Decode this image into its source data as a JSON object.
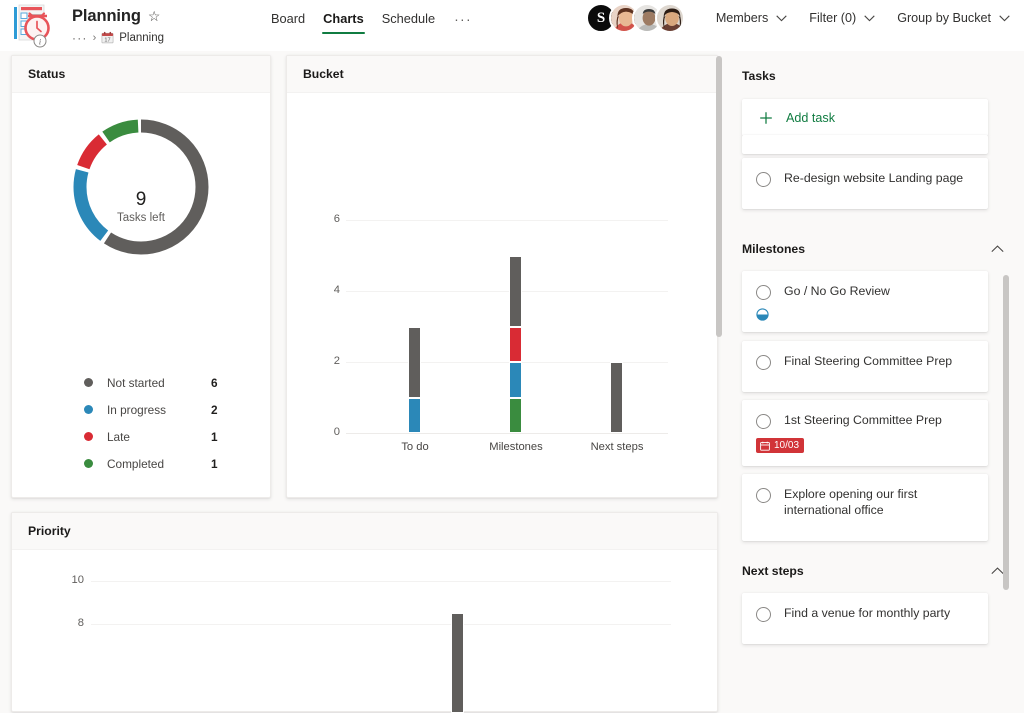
{
  "app": {
    "icon": "planner-app-icon",
    "plan_title": "Planning",
    "favorite_icon": "star-icon",
    "breadcrumb": {
      "overflow": "···",
      "separator": "›",
      "calendar_icon": "calendar-17-icon",
      "calendar_day": "17",
      "name": "Planning"
    }
  },
  "tabs": [
    {
      "label": "Board",
      "active": false
    },
    {
      "label": "Charts",
      "active": true
    },
    {
      "label": "Schedule",
      "active": false
    }
  ],
  "tabs_overflow": "···",
  "avatars": [
    {
      "name": "avatar-badge",
      "initial": "S",
      "type": "badge"
    },
    {
      "name": "avatar-person-1",
      "type": "photo"
    },
    {
      "name": "avatar-person-2",
      "type": "photo"
    },
    {
      "name": "avatar-person-3",
      "type": "photo"
    }
  ],
  "top_controls": [
    {
      "label": "Members",
      "icon": "chevron-down-icon"
    },
    {
      "label": "Filter (0)",
      "icon": "chevron-down-icon"
    },
    {
      "label": "Group by Bucket",
      "icon": "chevron-down-icon"
    }
  ],
  "cards": {
    "status_title": "Status",
    "bucket_title": "Bucket",
    "priority_title": "Priority"
  },
  "colors": {
    "not_started": "#605e5c",
    "in_progress": "#2b88b8",
    "late": "#d92b34",
    "completed": "#3a8c3f",
    "accent_green": "#107c41",
    "due_red": "#d13438"
  },
  "chart_data": [
    {
      "type": "pie",
      "name": "status-donut",
      "title": "Status",
      "center_value": "9",
      "center_label": "Tasks left",
      "total": 10,
      "categories": [
        "Not started",
        "In progress",
        "Late",
        "Completed"
      ],
      "values": [
        6,
        2,
        1,
        1
      ],
      "colors": [
        "#605e5c",
        "#2b88b8",
        "#d92b34",
        "#3a8c3f"
      ],
      "legend_position": "bottom",
      "donut": true,
      "start_angle": 0
    },
    {
      "type": "bar",
      "name": "bucket-stacked-bar",
      "title": "Bucket",
      "stacked": true,
      "categories": [
        "To do",
        "Milestones",
        "Next steps"
      ],
      "series": [
        {
          "name": "Completed",
          "color": "#3a8c3f",
          "values": [
            0,
            1,
            0
          ]
        },
        {
          "name": "In progress",
          "color": "#2b88b8",
          "values": [
            1,
            1,
            0
          ]
        },
        {
          "name": "Late",
          "color": "#d92b34",
          "values": [
            0,
            1,
            0
          ]
        },
        {
          "name": "Not started",
          "color": "#605e5c",
          "values": [
            2,
            2,
            2
          ]
        }
      ],
      "totals": [
        3,
        5,
        2
      ],
      "yticks": [
        0,
        2,
        4,
        6
      ],
      "ylim": [
        0,
        7
      ],
      "xlabel": "",
      "ylabel": "",
      "grid": true
    },
    {
      "type": "bar",
      "name": "priority-bar",
      "title": "Priority",
      "stacked": true,
      "clipped": true,
      "categories": [],
      "series": [
        {
          "name": "Not started",
          "color": "#605e5c",
          "values": [
            8.5
          ]
        }
      ],
      "yticks": [
        8,
        10
      ],
      "ylim": [
        0,
        11
      ],
      "grid": true
    }
  ],
  "sidebar": {
    "sections": [
      {
        "title": "Tasks",
        "collapse_icon": null,
        "add_task_label": "Add task",
        "add_task_icon": "plus-icon",
        "tasks": [
          {
            "label": "",
            "partial": true,
            "name": "task-card-partial"
          },
          {
            "label": "Re-design website Landing page",
            "check_icon": "circle-unchecked-icon"
          }
        ]
      },
      {
        "title": "Milestones",
        "collapse_icon": "chevron-up-icon",
        "tasks": [
          {
            "label": "Go / No Go Review",
            "check_icon": "circle-unchecked-icon",
            "progress_icon": "progress-half-icon"
          },
          {
            "label": "Final Steering Committee Prep",
            "check_icon": "circle-unchecked-icon"
          },
          {
            "label": "1st Steering Committee Prep",
            "check_icon": "circle-unchecked-icon",
            "due_date": "10/03",
            "due_icon": "calendar-icon",
            "due_overdue": true
          },
          {
            "label": "Explore opening our first international office",
            "check_icon": "circle-unchecked-icon"
          }
        ]
      },
      {
        "title": "Next steps",
        "collapse_icon": "chevron-up-icon",
        "tasks": [
          {
            "label": "Find a venue for monthly party",
            "check_icon": "circle-unchecked-icon"
          }
        ]
      }
    ]
  }
}
